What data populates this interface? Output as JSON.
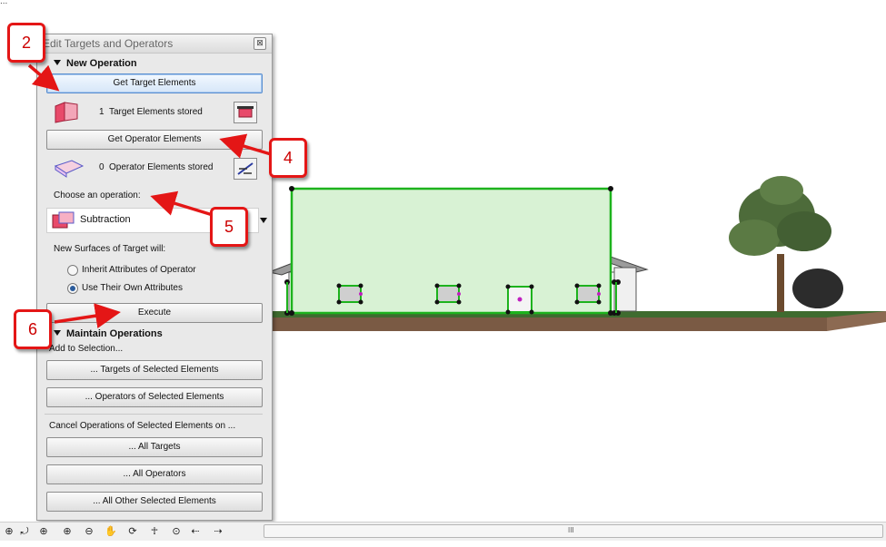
{
  "top_caption": "...",
  "palette": {
    "title": "Edit Targets and Operators",
    "close_glyph": "⊠",
    "new_operation": {
      "header": "New Operation",
      "get_target_button": "Get Target Elements",
      "target_count": "1",
      "target_stored_label": "Target Elements stored",
      "get_operator_button": "Get Operator Elements",
      "operator_count": "0",
      "operator_stored_label": "Operator Elements stored",
      "choose_label": "Choose an operation:",
      "operation_value": "Subtraction",
      "new_surfaces_label": "New Surfaces of Target will:",
      "radio_inherit": "Inherit Attributes of Operator",
      "radio_own": "Use Their Own Attributes",
      "execute_button": "Execute"
    },
    "maintain": {
      "header": "Maintain Operations",
      "add_label": "Add to Selection...",
      "targets_button": "... Targets of Selected Elements",
      "operators_button": "... Operators of Selected Elements",
      "cancel_label": "Cancel Operations of Selected Elements on ...",
      "all_targets_button": "... All Targets",
      "all_operators_button": "... All Operators",
      "all_other_button": "... All Other Selected Elements"
    }
  },
  "callouts": [
    "2",
    "4",
    "5",
    "6"
  ],
  "toolbar": {
    "icons": [
      "zoom-fit-icon",
      "zoom-previous-icon",
      "zoom-in-plus-icon",
      "zoom-in-icon",
      "zoom-out-icon",
      "pan-hand-icon",
      "orbit-icon",
      "walk-icon",
      "zoom-window-icon",
      "zoom-back-icon",
      "zoom-next-icon"
    ],
    "scroll_grip": "III"
  },
  "colors": {
    "callout_red": "#e41616",
    "selection_green": "#1db31d",
    "operator_fill": "#d8f2d4",
    "ground": "#7a5a44",
    "grass": "#3f6b2f"
  }
}
